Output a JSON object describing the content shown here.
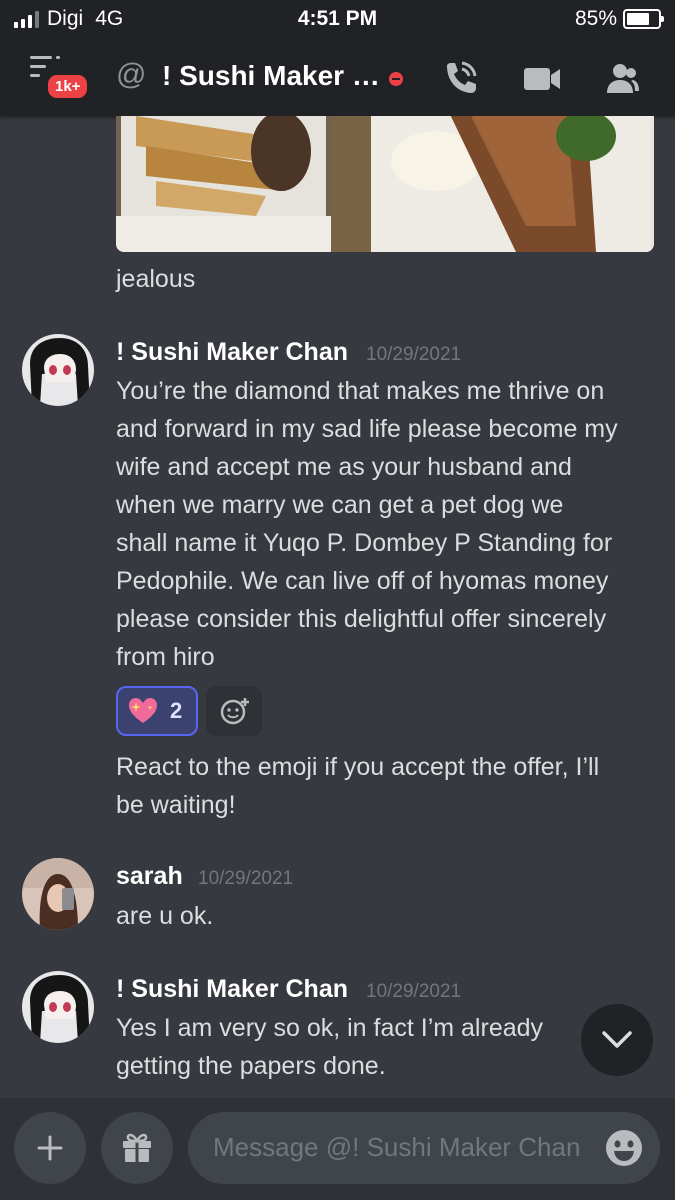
{
  "status_bar": {
    "carrier": "Digi",
    "network": "4G",
    "time": "4:51 PM",
    "battery": "85%",
    "battery_level": 0.85
  },
  "header": {
    "notification_badge": "1k+",
    "at_symbol": "@",
    "channel_title": "! Sushi Maker Chan",
    "icons": [
      "menu-icon",
      "phone-call-icon",
      "video-camera-icon",
      "members-icon"
    ]
  },
  "messages": [
    {
      "text": "jealous"
    },
    {
      "author": "! Sushi Maker Chan",
      "timestamp": "10/29/2021",
      "lines": [
        "You’re the diamond that makes me thrive on",
        "and forward in my sad life please become my",
        "wife and accept me as your husband and",
        "when we marry we can get a pet dog we",
        "shall name it Yuqo P. Dombey P Standing for",
        "Pedophile. We can live off of hyomas money",
        "please consider this delightful offer sincerely",
        "from hiro"
      ],
      "reaction": {
        "emoji": "sparkling-heart-icon",
        "count": "2"
      },
      "followup_lines": [
        "React to the emoji if you accept the offer, I’ll",
        "be waiting!"
      ]
    },
    {
      "author": "sarah",
      "timestamp": "10/29/2021",
      "text": "are u ok."
    },
    {
      "author": "! Sushi Maker Chan",
      "timestamp": "10/29/2021",
      "lines": [
        "Yes I am very so ok, in fact I’m already",
        "getting the papers done."
      ]
    }
  ],
  "composer": {
    "placeholder": "Message @! Sushi Maker Chan"
  },
  "colors": {
    "background": "#36393f",
    "header": "#202225",
    "accent": "#5865f2",
    "danger": "#ed4245"
  }
}
